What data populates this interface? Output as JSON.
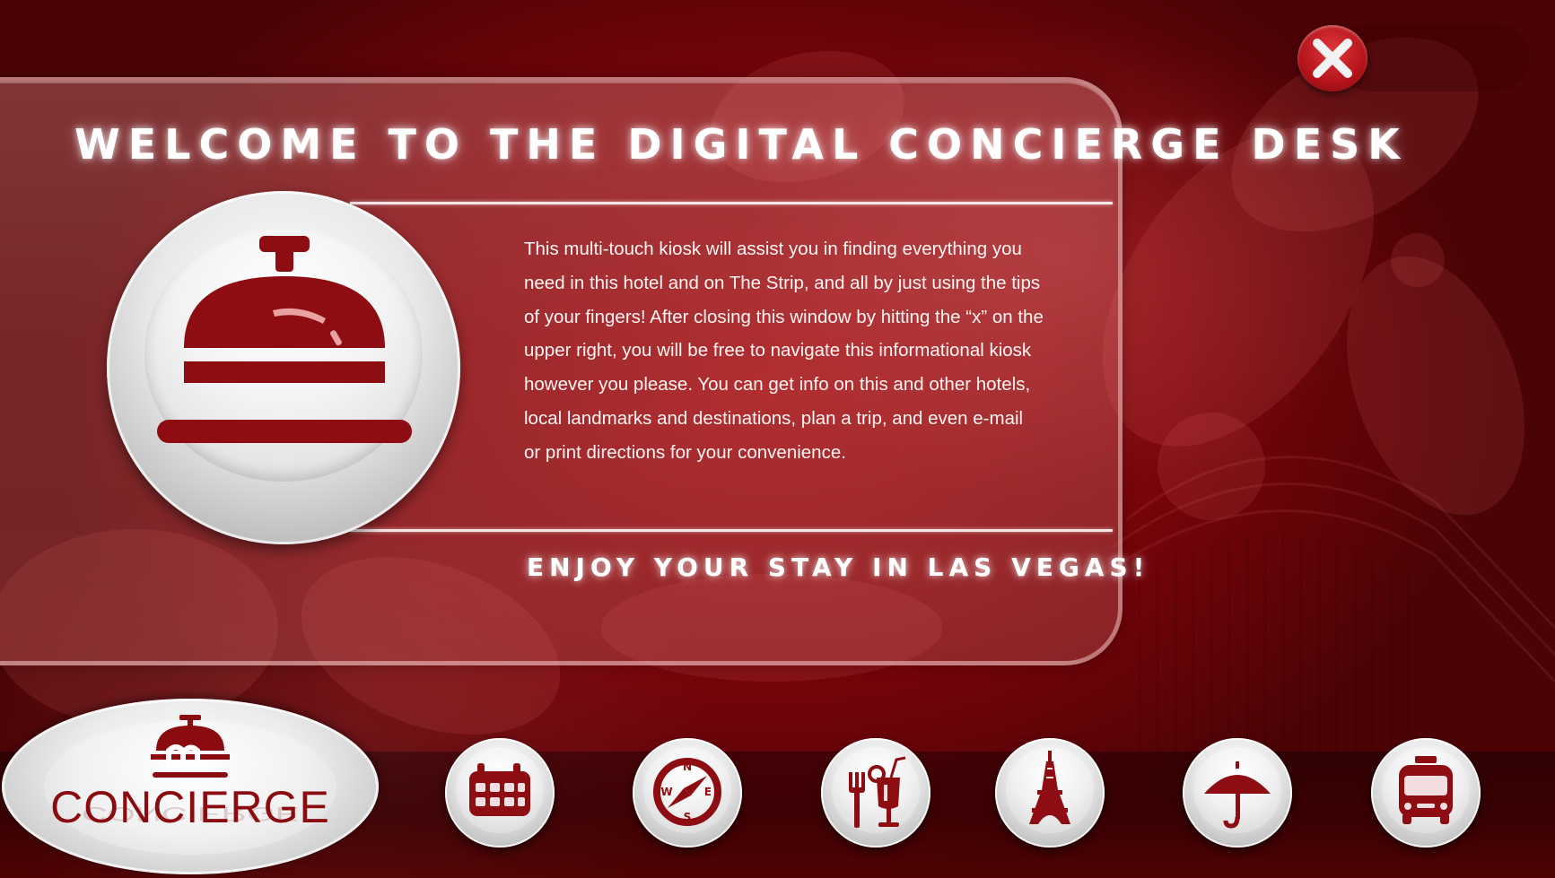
{
  "window": {
    "close_icon": "close-x-icon"
  },
  "welcome": {
    "title": "WELCOME TO THE DIGITAL CONCIERGE DESK",
    "body": "This multi-touch kiosk will assist you in finding everything you need in this hotel and on The Strip, and all by just using the tips of your fingers! After closing this window by hitting the “x” on the upper right, you will be free to navigate this informational kiosk however you please. You can get info on this and other hotels, local landmarks and destinations, plan a trip, and even e-mail or print directions for your convenience.",
    "closing": "ENJOY YOUR STAY IN LAS VEGAS!",
    "emblem_icon": "service-bell-icon"
  },
  "dock": {
    "concierge_label": "CONCIERGE",
    "items": [
      {
        "icon": "calendar-icon"
      },
      {
        "icon": "compass-icon"
      },
      {
        "icon": "dining-drinks-icon"
      },
      {
        "icon": "eiffel-tower-icon"
      },
      {
        "icon": "umbrella-icon"
      },
      {
        "icon": "bus-icon"
      }
    ]
  },
  "colors": {
    "background": "#8a070c",
    "accent": "#8a0b10",
    "panel_text": "#ffffff",
    "button_face": "#ececec"
  }
}
